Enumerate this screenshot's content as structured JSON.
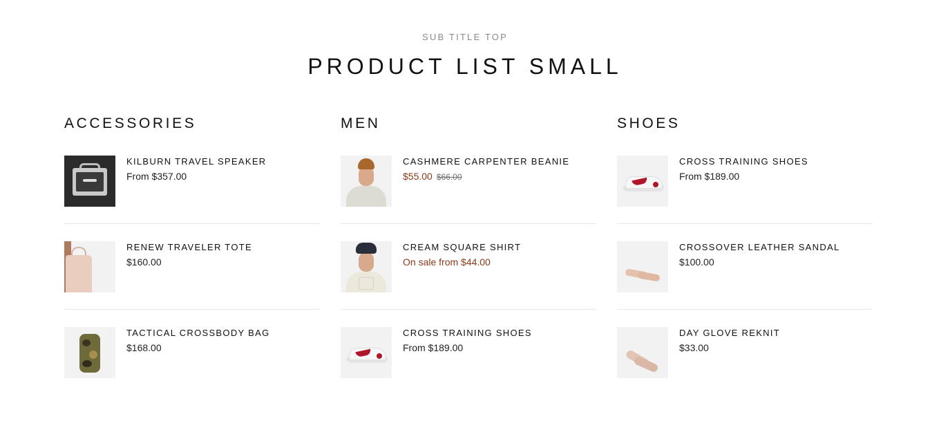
{
  "header": {
    "subtitle": "SUB TITLE TOP",
    "title": "PRODUCT LIST SMALL"
  },
  "colors": {
    "sale_price": "#8a3a1a",
    "text": "#111111",
    "divider": "#e8e8e8"
  },
  "columns": [
    {
      "title": "ACCESSORIES",
      "items": [
        {
          "name": "KILBURN TRAVEL SPEAKER",
          "price": "From $357.00",
          "image": "speaker"
        },
        {
          "name": "RENEW TRAVELER TOTE",
          "price": "$160.00",
          "image": "tote-bag"
        },
        {
          "name": "TACTICAL CROSSBODY BAG",
          "price": "$168.00",
          "image": "camo-bag"
        }
      ]
    },
    {
      "title": "MEN",
      "items": [
        {
          "name": "CASHMERE CARPENTER BEANIE",
          "price": "$55.00",
          "compare_price": "$66.00",
          "image": "man-beanie"
        },
        {
          "name": "CREAM SQUARE SHIRT",
          "price": "On sale from $44.00",
          "image": "man-shirt"
        },
        {
          "name": "CROSS TRAINING SHOES",
          "price": "From $189.00",
          "image": "sneaker"
        }
      ]
    },
    {
      "title": "SHOES",
      "items": [
        {
          "name": "CROSS TRAINING SHOES",
          "price": "From $189.00",
          "image": "sneaker"
        },
        {
          "name": "CROSSOVER LEATHER SANDAL",
          "price": "$100.00",
          "image": "sandal"
        },
        {
          "name": "DAY GLOVE REKNIT",
          "price": "$33.00",
          "image": "flat-shoe"
        }
      ]
    }
  ]
}
